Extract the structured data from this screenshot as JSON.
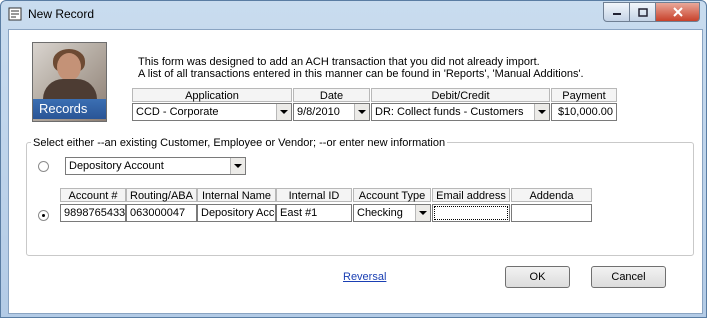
{
  "window": {
    "title": "New Record"
  },
  "header": {
    "image_label": "Records",
    "intro_line1": "This form was designed to add an ACH transaction that you did not already import.",
    "intro_line2": "A list of all transactions entered in this manner can be found in 'Reports', 'Manual Additions'."
  },
  "transaction": {
    "application_label": "Application",
    "application_value": "CCD - Corporate",
    "date_label": "Date",
    "date_value": "9/8/2010",
    "debit_credit_label": "Debit/Credit",
    "debit_credit_value": "DR: Collect funds - Customers",
    "payment_label": "Payment",
    "payment_value": "$10,000.00"
  },
  "selection": {
    "group_label": "Select either --an existing Customer, Employee or Vendor;  --or enter new information",
    "existing_value": "Depository Account",
    "existing_selected": false,
    "new_selected": true
  },
  "new_info": {
    "columns": [
      "Account #",
      "Routing/ABA #",
      "Internal Name",
      "Internal ID",
      "Account Type",
      "Email address",
      "Addenda Record"
    ],
    "account_number": "9898765433",
    "routing_number": "063000047",
    "internal_name": "Depository Account",
    "internal_id": "East #1",
    "account_type": "Checking",
    "email": "",
    "addenda": ""
  },
  "footer": {
    "reversal_link": "Reversal",
    "ok_label": "OK",
    "cancel_label": "Cancel"
  }
}
